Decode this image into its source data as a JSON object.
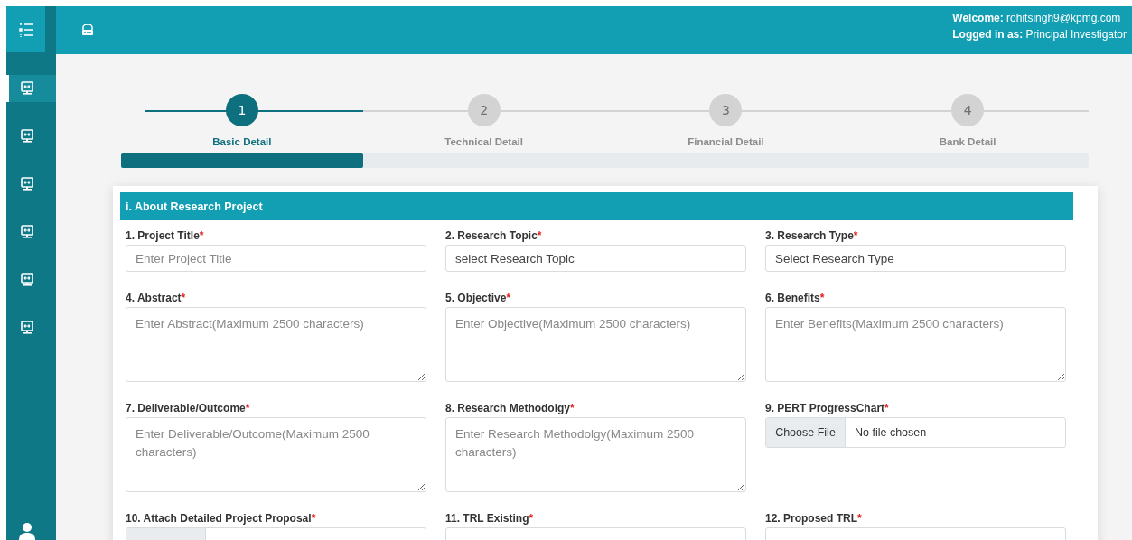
{
  "sidebar": {
    "items": [
      {
        "selected": true
      },
      {
        "selected": false
      },
      {
        "selected": false
      },
      {
        "selected": false
      },
      {
        "selected": false
      },
      {
        "selected": false
      }
    ]
  },
  "header": {
    "welcome": "**Welcome:** rohitsingh9@kpmg.com",
    "role": "**Logged in as:** Principal Investigator"
  },
  "stepper": {
    "steps": [
      {
        "number": "1",
        "label": "Basic Detail",
        "selected": true
      },
      {
        "number": "2",
        "label": "Technical Detail",
        "selected": false
      },
      {
        "number": "3",
        "label": "Financial Detail",
        "selected": false
      },
      {
        "number": "4",
        "label": "Bank Detail",
        "selected": false
      }
    ],
    "level": 0.25
  },
  "section": {
    "title": "i. About Research Project",
    "fields": [
      {
        "label": "1. Project Title",
        "mark": "*",
        "kind": "input",
        "placeholder": "Enter Project Title"
      },
      {
        "label": "2. Research Topic",
        "mark": "*",
        "kind": "select",
        "value": "select Research Topic"
      },
      {
        "label": "3. Research Type",
        "mark": "*",
        "kind": "select",
        "value": "Select Research Type"
      },
      {
        "label": "4. Abstract",
        "mark": "*",
        "kind": "textarea",
        "placeholder": "Enter Abstract(Maximum 2500 characters)"
      },
      {
        "label": "5. Objective",
        "mark": "*",
        "kind": "textarea",
        "placeholder": "Enter Objective(Maximum 2500 characters)"
      },
      {
        "label": "6. Benefits",
        "mark": "*",
        "kind": "textarea",
        "placeholder": "Enter Benefits(Maximum 2500 characters)"
      },
      {
        "label": "7. Deliverable/Outcome",
        "mark": "*",
        "kind": "textarea",
        "placeholder": "Enter Deliverable/Outcome(Maximum 2500 characters)"
      },
      {
        "label": "8. Research Methodolgy",
        "mark": "*",
        "kind": "textarea",
        "placeholder": "Enter Research Methodolgy(Maximum 2500 characters)"
      },
      {
        "label": "9. PERT ProgressChart",
        "mark": "*",
        "kind": "file",
        "button_label": "Choose File",
        "status": "No file chosen"
      },
      {
        "label": "10. Attach Detailed Project Proposal",
        "mark": "*",
        "kind": "file"
      },
      {
        "label": "11. TRL Existing",
        "mark": "*",
        "kind": "input"
      },
      {
        "label": "12. Proposed TRL",
        "mark": "*",
        "kind": "input"
      }
    ]
  }
}
